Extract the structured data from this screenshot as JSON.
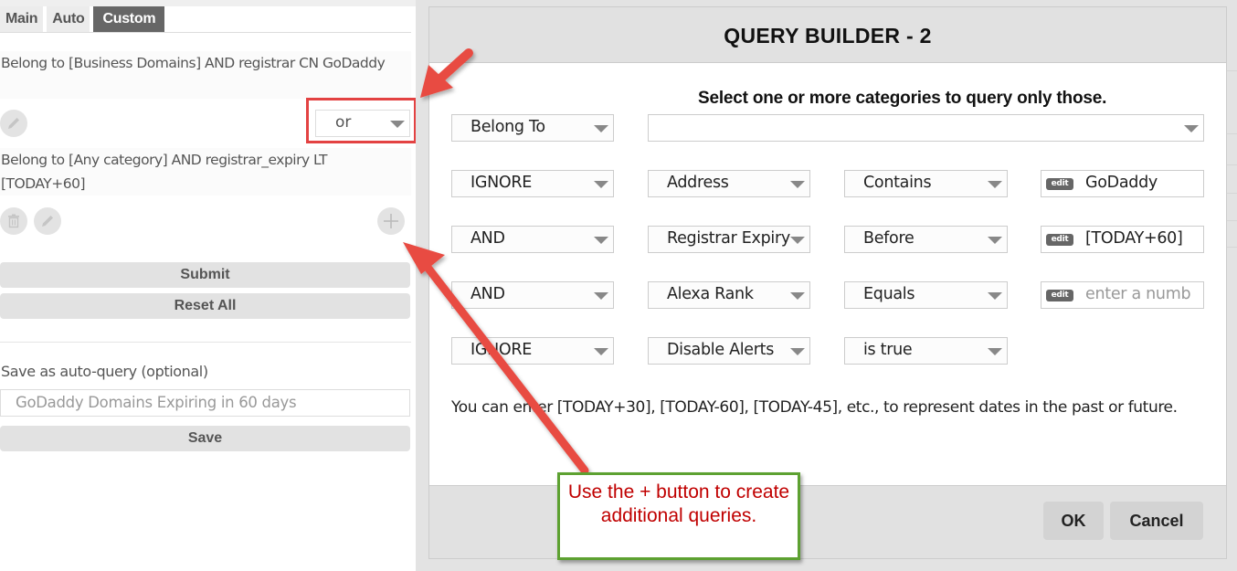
{
  "left_panel": {
    "tabs": [
      {
        "label": "Main",
        "active": false
      },
      {
        "label": "Auto",
        "active": false
      },
      {
        "label": "Custom",
        "active": true
      }
    ],
    "queries": [
      {
        "description": "Belong to [Business Domains] AND registrar CN GoDaddy",
        "actions": [
          "edit-icon"
        ]
      },
      {
        "description": "Belong to [Any category] AND registrar_expiry LT [TODAY+60]",
        "actions": [
          "trash-icon",
          "edit-icon"
        ]
      }
    ],
    "join_operator": "or",
    "add_query_icon": "plus-icon",
    "submit_label": "Submit",
    "reset_label": "Reset All",
    "save_section_label": "Save as auto-query (optional)",
    "save_input_value": "GoDaddy Domains Expiring in 60 days",
    "save_label": "Save"
  },
  "modal": {
    "title": "QUERY BUILDER - 2",
    "hint": "Select one or more categories to query only those.",
    "category_row": {
      "scope": "Belong To",
      "categories": ""
    },
    "conditions": [
      {
        "logic": "IGNORE",
        "field": "Address",
        "operator": "Contains",
        "value": "GoDaddy",
        "placeholder": ""
      },
      {
        "logic": "AND",
        "field": "Registrar Expiry",
        "operator": "Before",
        "value": "[TODAY+60]",
        "placeholder": ""
      },
      {
        "logic": "AND",
        "field": "Alexa Rank",
        "operator": "Equals",
        "value": "",
        "placeholder": "enter a numb"
      },
      {
        "logic": "IGNORE",
        "field": "Disable Alerts",
        "operator": "is true",
        "value": null,
        "placeholder": ""
      }
    ],
    "edit_badge": "edit",
    "note": "You can enter [TODAY+30], [TODAY-60], [TODAY-45], etc., to represent dates in the past or future.",
    "ok_label": "OK",
    "cancel_label": "Cancel"
  },
  "annotation": {
    "callout_text": "Use the + button to create additional queries.",
    "arrow_color": "#e84c43",
    "highlight_color": "#e34242",
    "callout_border_color": "#5da131",
    "callout_text_color": "#c00000"
  }
}
